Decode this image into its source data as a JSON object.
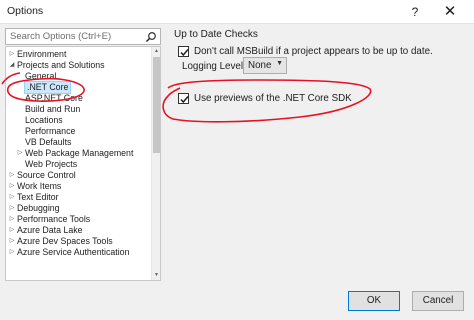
{
  "window": {
    "title": "Options",
    "help_glyph": "?",
    "close_glyph": "✕"
  },
  "search": {
    "placeholder": "Search Options (Ctrl+E)"
  },
  "tree": [
    {
      "label": "Environment",
      "level": 0,
      "expander": "collapsed"
    },
    {
      "label": "Projects and Solutions",
      "level": 0,
      "expander": "expanded"
    },
    {
      "label": "General",
      "level": 1,
      "expander": "none"
    },
    {
      "label": ".NET Core",
      "level": 1,
      "expander": "none",
      "selected": true
    },
    {
      "label": "ASP.NET Core",
      "level": 1,
      "expander": "none"
    },
    {
      "label": "Build and Run",
      "level": 1,
      "expander": "none"
    },
    {
      "label": "Locations",
      "level": 1,
      "expander": "none"
    },
    {
      "label": "Performance",
      "level": 1,
      "expander": "none"
    },
    {
      "label": "VB Defaults",
      "level": 1,
      "expander": "none"
    },
    {
      "label": "Web Package Management",
      "level": 1,
      "expander": "collapsed"
    },
    {
      "label": "Web Projects",
      "level": 1,
      "expander": "none"
    },
    {
      "label": "Source Control",
      "level": 0,
      "expander": "collapsed"
    },
    {
      "label": "Work Items",
      "level": 0,
      "expander": "collapsed"
    },
    {
      "label": "Text Editor",
      "level": 0,
      "expander": "collapsed"
    },
    {
      "label": "Debugging",
      "level": 0,
      "expander": "collapsed"
    },
    {
      "label": "Performance Tools",
      "level": 0,
      "expander": "collapsed"
    },
    {
      "label": "Azure Data Lake",
      "level": 0,
      "expander": "collapsed"
    },
    {
      "label": "Azure Dev Spaces Tools",
      "level": 0,
      "expander": "collapsed"
    },
    {
      "label": "Azure Service Authentication",
      "level": 0,
      "expander": "collapsed"
    }
  ],
  "panel": {
    "section_title": "Up to Date Checks",
    "dont_call_msbuild": {
      "label": "Don't call MSBuild if a project appears to be up to date.",
      "checked": true
    },
    "logging_level": {
      "label": "Logging Level:",
      "value": "None"
    },
    "use_previews": {
      "label": "Use previews of the .NET Core SDK",
      "checked": true
    }
  },
  "buttons": {
    "ok": "OK",
    "cancel": "Cancel"
  },
  "colors": {
    "annotation": "#e81123",
    "selection": "#cce8ff",
    "accent_border": "#0078d7"
  }
}
